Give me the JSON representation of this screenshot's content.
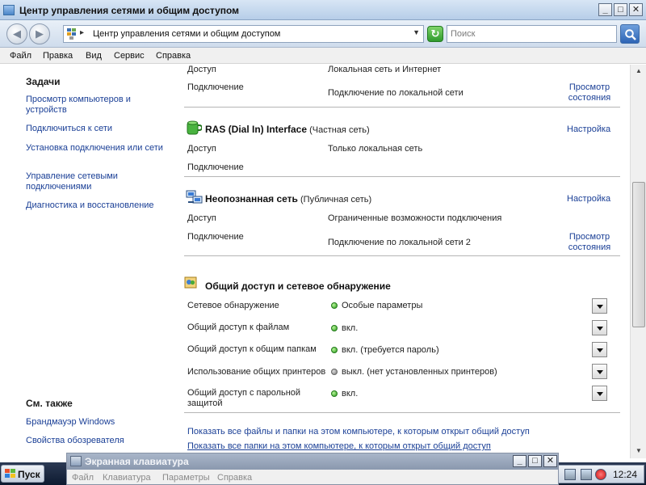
{
  "window": {
    "title": "Центр управления сетями и общим доступом",
    "controls": {
      "minimize": "_",
      "maximize": "□",
      "close": "✕"
    }
  },
  "addressbar": {
    "back_glyph": "◀",
    "forward_glyph": "▶",
    "path": "Центр управления сетями и общим доступом",
    "separator": "▸",
    "dropdown": "▼",
    "go_glyph": "↻",
    "search_placeholder": "Поиск"
  },
  "menubar": {
    "items": [
      "Файл",
      "Правка",
      "Вид",
      "Сервис",
      "Справка"
    ]
  },
  "sidebar": {
    "tasks_heading": "Задачи",
    "tasks": [
      "Просмотр компьютеров и устройств",
      "Подключиться к сети",
      "Установка подключения или сети",
      "Управление сетевыми подключениями",
      "Диагностика и восстановление"
    ],
    "see_also_heading": "См. также",
    "see_also": [
      "Брандмауэр Windows",
      "Свойства обозревателя"
    ]
  },
  "networks": {
    "first": {
      "access_label": "Доступ",
      "access_value": "Локальная сеть и Интернет",
      "connection_label": "Подключение",
      "connection_value": "Подключение по локальной сети",
      "view_status_link": "Просмотр состояния"
    },
    "ras": {
      "name": "RAS (Dial In) Interface",
      "type": "(Частная сеть)",
      "configure_link": "Настройка",
      "access_label": "Доступ",
      "access_value": "Только локальная сеть",
      "connection_label": "Подключение"
    },
    "unknown": {
      "name": "Неопознанная сеть",
      "type": "(Публичная сеть)",
      "configure_link": "Настройка",
      "access_label": "Доступ",
      "access_value": "Ограниченные возможности подключения",
      "connection_label": "Подключение",
      "connection_value": "Подключение по локальной сети 2",
      "view_status_link": "Просмотр состояния"
    }
  },
  "sharing": {
    "heading": "Общий доступ и сетевое обнаружение",
    "rows": [
      {
        "label": "Сетевое обнаружение",
        "value": "Особые параметры",
        "state": "on"
      },
      {
        "label": "Общий доступ к файлам",
        "value": "вкл.",
        "state": "on"
      },
      {
        "label": "Общий доступ к общим папкам",
        "value": "вкл. (требуется пароль)",
        "state": "on"
      },
      {
        "label": "Использование общих принтеров",
        "value": "выкл. (нет установленных принтеров)",
        "state": "off"
      },
      {
        "label": "Общий доступ с парольной защитой",
        "value": "вкл.",
        "state": "on"
      }
    ],
    "show_files_link": "Показать все файлы и папки на этом компьютере, к которым открыт общий доступ",
    "show_folders_link": "Показать все папки на этом компьютере, к которым открыт общий доступ"
  },
  "taskbar": {
    "start_label": "Пуск",
    "clock": "12:24"
  },
  "osk": {
    "title": "Экранная клавиатура",
    "menu": [
      "Файл",
      "Клавиатура",
      "Параметры",
      "Справка"
    ]
  },
  "colors": {
    "link": "#1a3f96",
    "status_on": "#2a9a1c",
    "status_off": "#7a7a7a"
  }
}
